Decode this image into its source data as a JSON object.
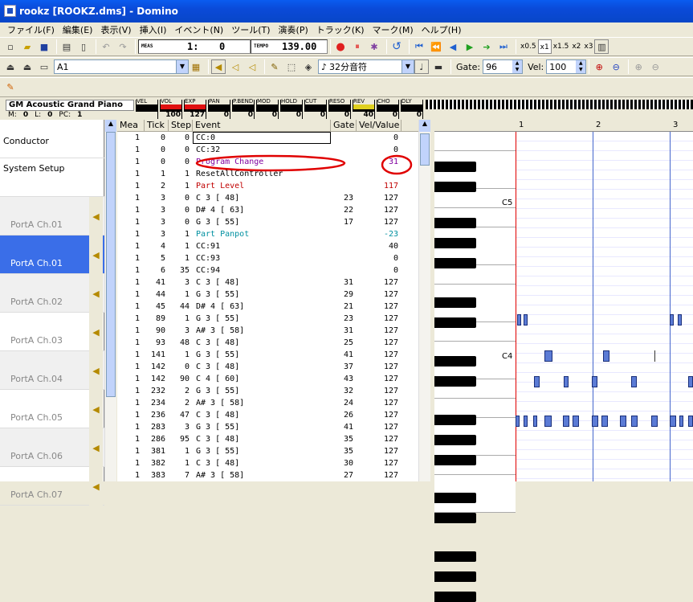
{
  "window": {
    "title": "rookz    [ROOKZ.dms] - Domino"
  },
  "menu": [
    "ファイル(F)",
    "編集(E)",
    "表示(V)",
    "挿入(I)",
    "イベント(N)",
    "ツール(T)",
    "演奏(P)",
    "トラック(K)",
    "マーク(M)",
    "ヘルプ(H)"
  ],
  "toolbar": {
    "meas_label": "MEAS",
    "meas_value": "1:",
    "tick_value": "0",
    "tempo_label": "TEMPO",
    "tempo_value": "139.00",
    "speeds": [
      "x0.5",
      "x1",
      "x1.5",
      "x2",
      "x3"
    ],
    "track_select": "A1",
    "note_length": "32分音符",
    "gate_label": "Gate:",
    "gate_value": "96",
    "vel_label": "Vel:",
    "vel_value": "100"
  },
  "instrument": {
    "name": "GM Acoustic Grand Piano",
    "m_label": "M:",
    "m_value": "0",
    "l_label": "L:",
    "l_value": "0",
    "pc_label": "PC:",
    "pc_value": "1"
  },
  "meters": [
    {
      "label": "VEL",
      "value": "",
      "color": "#000000"
    },
    {
      "label": "VOL",
      "value": "100",
      "color": "#e01010"
    },
    {
      "label": "EXP",
      "value": "127",
      "color": "#e01010"
    },
    {
      "label": "PAN",
      "value": "0",
      "color": "#000000"
    },
    {
      "label": "P.BEND",
      "value": "0",
      "color": "#000000"
    },
    {
      "label": "MOD",
      "value": "0",
      "color": "#000000"
    },
    {
      "label": "HOLD",
      "value": "0",
      "color": "#000000"
    },
    {
      "label": "CUT",
      "value": "0",
      "color": "#000000"
    },
    {
      "label": "RESO",
      "value": "0",
      "color": "#000000"
    },
    {
      "label": "REV",
      "value": "40",
      "color": "#e0d020"
    },
    {
      "label": "CHO",
      "value": "0",
      "color": "#000000"
    },
    {
      "label": "DLY",
      "value": "0",
      "color": "#000000"
    }
  ],
  "tracks": [
    {
      "name": "Conductor",
      "selected": false
    },
    {
      "name": "System Setup",
      "selected": false
    },
    {
      "name": "PortA  Ch.01",
      "selected": false
    },
    {
      "name": "PortA  Ch.01",
      "selected": true
    },
    {
      "name": "PortA  Ch.02",
      "selected": false
    },
    {
      "name": "PortA  Ch.03",
      "selected": false
    },
    {
      "name": "PortA  Ch.04",
      "selected": false
    },
    {
      "name": "PortA  Ch.05",
      "selected": false
    },
    {
      "name": "PortA  Ch.06",
      "selected": false
    },
    {
      "name": "PortA  Ch.07",
      "selected": false
    }
  ],
  "event_headers": [
    "Mea",
    "Tick",
    "Step",
    "Event",
    "Gate",
    "Vel/Value"
  ],
  "events": [
    {
      "mea": "1",
      "tick": "0",
      "step": "0",
      "event": "CC:0",
      "gate": "",
      "value": "0",
      "color": "#000000"
    },
    {
      "mea": "1",
      "tick": "0",
      "step": "0",
      "event": "CC:32",
      "gate": "",
      "value": "0",
      "color": "#000000"
    },
    {
      "mea": "1",
      "tick": "0",
      "step": "0",
      "event": "Program Change",
      "gate": "",
      "value": "31",
      "color": "#8000a0"
    },
    {
      "mea": "1",
      "tick": "1",
      "step": "1",
      "event": "ResetAllController",
      "gate": "",
      "value": "",
      "color": "#000000"
    },
    {
      "mea": "1",
      "tick": "2",
      "step": "1",
      "event": "Part Level",
      "gate": "",
      "value": "117",
      "color": "#c00000"
    },
    {
      "mea": "1",
      "tick": "3",
      "step": "0",
      "event": "C  3 [ 48]",
      "gate": "23",
      "value": "127",
      "color": "#000000"
    },
    {
      "mea": "1",
      "tick": "3",
      "step": "0",
      "event": "D# 4 [ 63]",
      "gate": "22",
      "value": "127",
      "color": "#000000"
    },
    {
      "mea": "1",
      "tick": "3",
      "step": "0",
      "event": "G  3 [ 55]",
      "gate": "17",
      "value": "127",
      "color": "#000000"
    },
    {
      "mea": "1",
      "tick": "3",
      "step": "1",
      "event": "Part Panpot",
      "gate": "",
      "value": "-23",
      "color": "#0090a0"
    },
    {
      "mea": "1",
      "tick": "4",
      "step": "1",
      "event": "CC:91",
      "gate": "",
      "value": "40",
      "color": "#000000"
    },
    {
      "mea": "1",
      "tick": "5",
      "step": "1",
      "event": "CC:93",
      "gate": "",
      "value": "0",
      "color": "#000000"
    },
    {
      "mea": "1",
      "tick": "6",
      "step": "35",
      "event": "CC:94",
      "gate": "",
      "value": "0",
      "color": "#000000"
    },
    {
      "mea": "1",
      "tick": "41",
      "step": "3",
      "event": "C  3 [ 48]",
      "gate": "31",
      "value": "127",
      "color": "#000000"
    },
    {
      "mea": "1",
      "tick": "44",
      "step": "1",
      "event": "G  3 [ 55]",
      "gate": "29",
      "value": "127",
      "color": "#000000"
    },
    {
      "mea": "1",
      "tick": "45",
      "step": "44",
      "event": "D# 4 [ 63]",
      "gate": "21",
      "value": "127",
      "color": "#000000"
    },
    {
      "mea": "1",
      "tick": "89",
      "step": "1",
      "event": "G  3 [ 55]",
      "gate": "23",
      "value": "127",
      "color": "#000000"
    },
    {
      "mea": "1",
      "tick": "90",
      "step": "3",
      "event": "A# 3 [ 58]",
      "gate": "31",
      "value": "127",
      "color": "#000000"
    },
    {
      "mea": "1",
      "tick": "93",
      "step": "48",
      "event": "C  3 [ 48]",
      "gate": "25",
      "value": "127",
      "color": "#000000"
    },
    {
      "mea": "1",
      "tick": "141",
      "step": "1",
      "event": "G  3 [ 55]",
      "gate": "41",
      "value": "127",
      "color": "#000000"
    },
    {
      "mea": "1",
      "tick": "142",
      "step": "0",
      "event": "C  3 [ 48]",
      "gate": "37",
      "value": "127",
      "color": "#000000"
    },
    {
      "mea": "1",
      "tick": "142",
      "step": "90",
      "event": "C  4 [ 60]",
      "gate": "43",
      "value": "127",
      "color": "#000000"
    },
    {
      "mea": "1",
      "tick": "232",
      "step": "2",
      "event": "G  3 [ 55]",
      "gate": "32",
      "value": "127",
      "color": "#000000"
    },
    {
      "mea": "1",
      "tick": "234",
      "step": "2",
      "event": "A# 3 [ 58]",
      "gate": "24",
      "value": "127",
      "color": "#000000"
    },
    {
      "mea": "1",
      "tick": "236",
      "step": "47",
      "event": "C  3 [ 48]",
      "gate": "26",
      "value": "127",
      "color": "#000000"
    },
    {
      "mea": "1",
      "tick": "283",
      "step": "3",
      "event": "G  3 [ 55]",
      "gate": "41",
      "value": "127",
      "color": "#000000"
    },
    {
      "mea": "1",
      "tick": "286",
      "step": "95",
      "event": "C  3 [ 48]",
      "gate": "35",
      "value": "127",
      "color": "#000000"
    },
    {
      "mea": "1",
      "tick": "381",
      "step": "1",
      "event": "G  3 [ 55]",
      "gate": "35",
      "value": "127",
      "color": "#000000"
    },
    {
      "mea": "1",
      "tick": "382",
      "step": "1",
      "event": "C  3 [ 48]",
      "gate": "30",
      "value": "127",
      "color": "#000000"
    },
    {
      "mea": "1",
      "tick": "383",
      "step": "7",
      "event": "A# 3 [ 58]",
      "gate": "27",
      "value": "127",
      "color": "#000000"
    }
  ],
  "piano": {
    "measures": [
      "1",
      "2",
      "3"
    ],
    "octave_labels": [
      "C5",
      "C4"
    ]
  }
}
